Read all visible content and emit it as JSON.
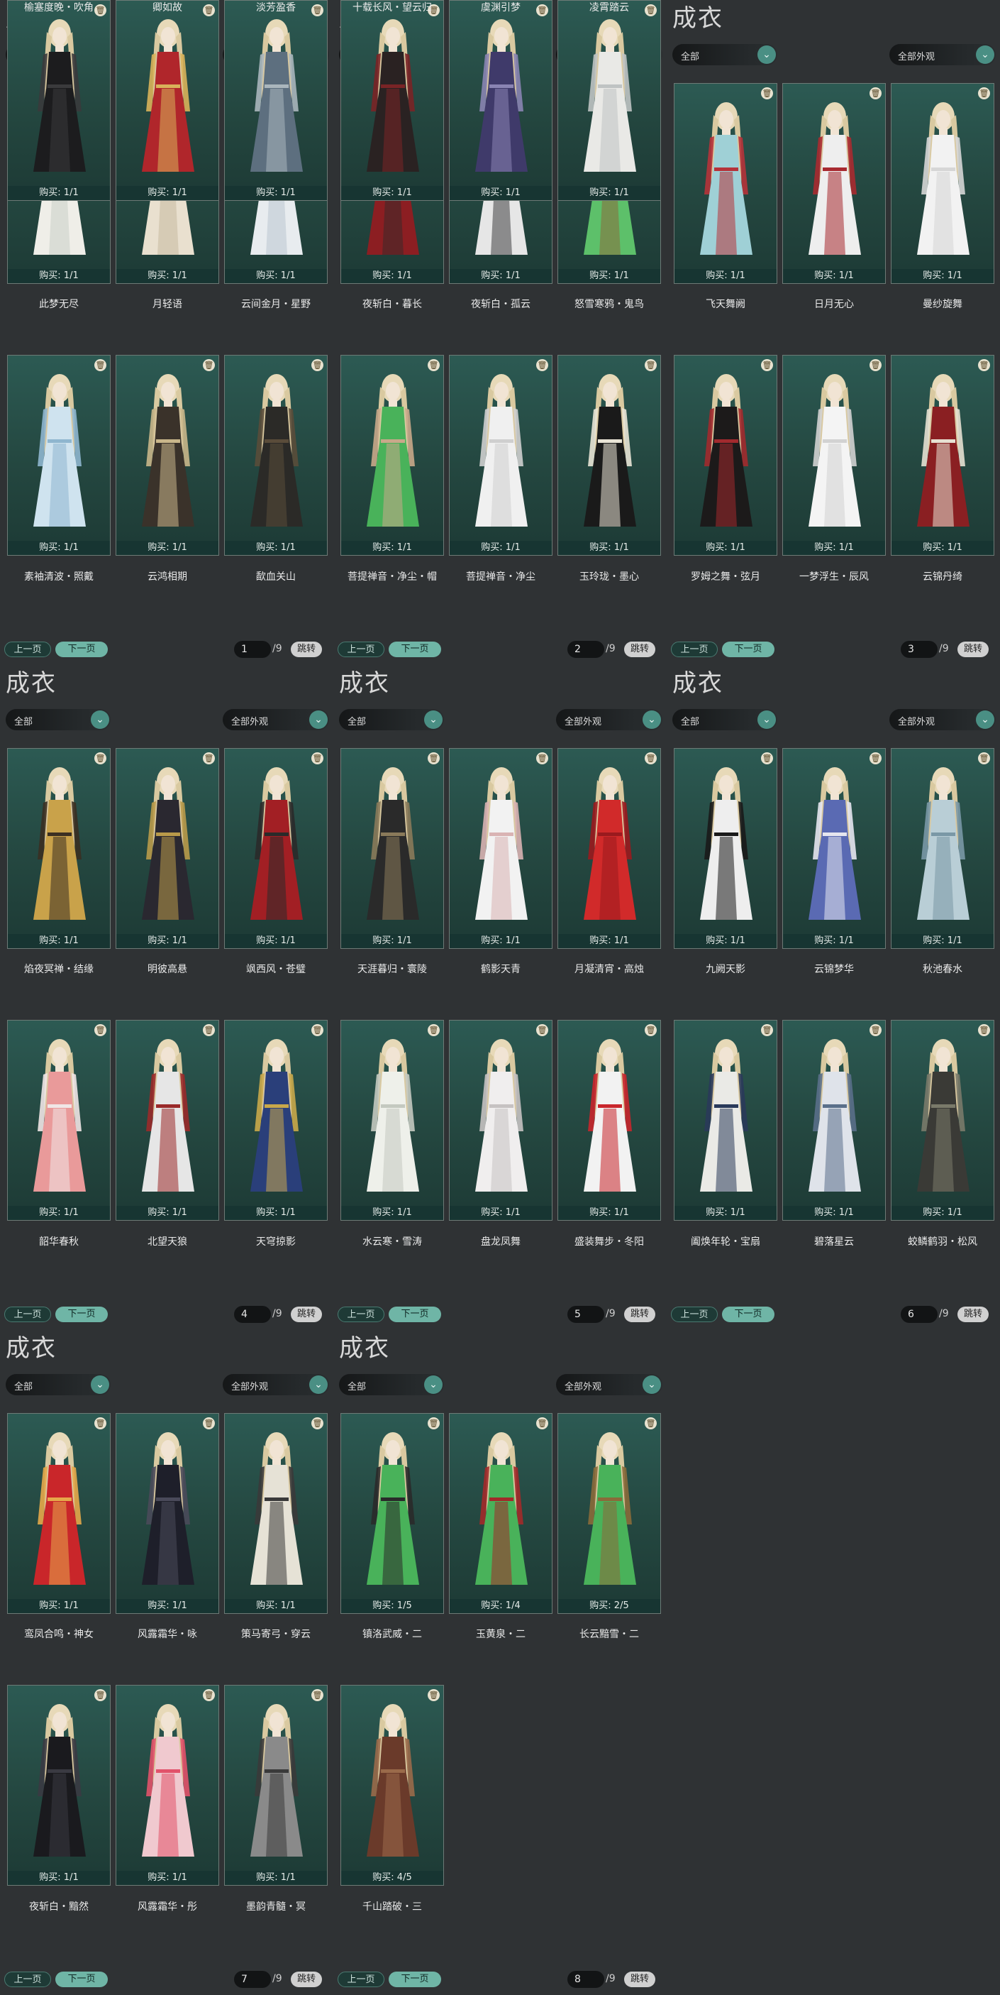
{
  "title": "成衣",
  "filter_all": "全部",
  "filter_appearance": "全部外观",
  "prev_label": "上一页",
  "next_label": "下一页",
  "jump_label": "跳转",
  "total_pages": "/9",
  "colors": {
    "accent": "#6fb5a6",
    "card_bg": "#2c5a53",
    "page_bg": "#2f3234"
  },
  "pages": [
    {
      "page": "1",
      "items": [
        {
          "name": "此梦无尽",
          "buy": "购买: 1/1",
          "c1": "#efeee8",
          "c2": "#c9cfc6"
        },
        {
          "name": "月轻语",
          "buy": "购买: 1/1",
          "c1": "#e9e0cf",
          "c2": "#c7b9a0"
        },
        {
          "name": "云间金月・星野",
          "buy": "购买: 1/1",
          "c1": "#e8ecef",
          "c2": "#b9c7cf"
        },
        {
          "name": "素袖清波・照戴",
          "buy": "购买: 1/1",
          "c1": "#cfe3ef",
          "c2": "#8fb6cf"
        },
        {
          "name": "云鸿相期",
          "buy": "购买: 1/1",
          "c1": "#3a322a",
          "c2": "#c9b68a"
        },
        {
          "name": "歃血关山",
          "buy": "购买: 1/1",
          "c1": "#2b2a27",
          "c2": "#5a4c3a"
        },
        {
          "name": "榆塞度晚・吹角",
          "buy": "购买: 1/1",
          "c1": "#1c1c1e",
          "c2": "#3a3a3c"
        },
        {
          "name": "卿如故",
          "buy": "购买: 1/1",
          "c1": "#b0262b",
          "c2": "#d9b25a"
        },
        {
          "name": "淡芳盈香",
          "buy": "购买: 1/1",
          "c1": "#5d6f7f",
          "c2": "#aab6bd"
        }
      ]
    },
    {
      "page": "2",
      "items": [
        {
          "name": "夜斩白・暮长",
          "buy": "购买: 1/1",
          "c1": "#8c1e22",
          "c2": "#3a2a2a"
        },
        {
          "name": "夜斩白・孤云",
          "buy": "购买: 1/1",
          "c1": "#e6e6e6",
          "c2": "#3f3f42"
        },
        {
          "name": "怒雪寒鸦・鬼鸟",
          "buy": "购买: 1/1",
          "c1": "#5dc06a",
          "c2": "#8a6a3a"
        },
        {
          "name": "菩提禅音・净尘・帽",
          "buy": "购买: 1/1",
          "c1": "#49b25a",
          "c2": "#c9a88a"
        },
        {
          "name": "菩提禅音・净尘",
          "buy": "购买: 1/1",
          "c1": "#f0f0f0",
          "c2": "#cfcfcf"
        },
        {
          "name": "玉玲珑・墨心",
          "buy": "购买: 1/1",
          "c1": "#1a1a1a",
          "c2": "#e9e4d6"
        },
        {
          "name": "十载长风・望云归",
          "buy": "购买: 1/1",
          "c1": "#2a2222",
          "c2": "#7a2426"
        },
        {
          "name": "虞渊引梦",
          "buy": "购买: 1/1",
          "c1": "#3f3a6a",
          "c2": "#8a84b3"
        },
        {
          "name": "凌霄踏云",
          "buy": "购买: 1/1",
          "c1": "#e9e9e6",
          "c2": "#bfc3c3"
        }
      ]
    },
    {
      "page": "3",
      "items": [
        {
          "name": "飞天舞阙",
          "buy": "购买: 1/1",
          "c1": "#9fd0d6",
          "c2": "#b6333a"
        },
        {
          "name": "日月无心",
          "buy": "购买: 1/1",
          "c1": "#eeeeee",
          "c2": "#a82a30"
        },
        {
          "name": "曼纱旋舞",
          "buy": "购买: 1/1",
          "c1": "#f2f2f2",
          "c2": "#d6d6d6"
        },
        {
          "name": "罗姆之舞・弦月",
          "buy": "购买: 1/1",
          "c1": "#1c1a1a",
          "c2": "#a22a2e"
        },
        {
          "name": "一梦浮生・辰风",
          "buy": "购买: 1/1",
          "c1": "#f4f4f4",
          "c2": "#d2d2d2"
        },
        {
          "name": "云锦丹绮",
          "buy": "购买: 1/1",
          "c1": "#8a1f22",
          "c2": "#e6e0d2"
        }
      ]
    },
    {
      "page": "4",
      "items": [
        {
          "name": "焰夜冥禅・结缘",
          "buy": "购买: 1/1",
          "c1": "#c9a24a",
          "c2": "#3a2f22"
        },
        {
          "name": "明彼高悬",
          "buy": "购买: 1/1",
          "c1": "#2a2830",
          "c2": "#b99a4a"
        },
        {
          "name": "飒西风・苍璧",
          "buy": "购买: 1/1",
          "c1": "#a21f24",
          "c2": "#2a2a2a"
        },
        {
          "name": "韶华春秋",
          "buy": "购买: 1/1",
          "c1": "#e99a9a",
          "c2": "#f0e6e6"
        },
        {
          "name": "北望天狼",
          "buy": "购买: 1/1",
          "c1": "#e6e6e6",
          "c2": "#9a2a2a"
        },
        {
          "name": "天穹掠影",
          "buy": "购买: 1/1",
          "c1": "#2a3f7a",
          "c2": "#c9a84a"
        }
      ]
    },
    {
      "page": "5",
      "items": [
        {
          "name": "天涯暮归・寰陵",
          "buy": "购买: 1/1",
          "c1": "#2a2a2a",
          "c2": "#8a7a5a"
        },
        {
          "name": "鹤影天青",
          "buy": "购买: 1/1",
          "c1": "#f2f2f2",
          "c2": "#d9b3b3"
        },
        {
          "name": "月凝清宵・高烛",
          "buy": "购买: 1/1",
          "c1": "#d12a2a",
          "c2": "#9a1a1e"
        },
        {
          "name": "水云寒・雪涛",
          "buy": "购买: 1/1",
          "c1": "#eef0ea",
          "c2": "#c4c9c0"
        },
        {
          "name": "盘龙凤舞",
          "buy": "购买: 1/1",
          "c1": "#f0eeee",
          "c2": "#c6c2c2"
        },
        {
          "name": "盛装舞步・冬阳",
          "buy": "购买: 1/1",
          "c1": "#f2f2f2",
          "c2": "#c9262c"
        }
      ]
    },
    {
      "page": "6",
      "items": [
        {
          "name": "九阙天影",
          "buy": "购买: 1/1",
          "c1": "#eeeeee",
          "c2": "#1a1a1a"
        },
        {
          "name": "云锦梦华",
          "buy": "购买: 1/1",
          "c1": "#5a6ab3",
          "c2": "#e6e6ef"
        },
        {
          "name": "秋池春水",
          "buy": "购买: 1/1",
          "c1": "#b9ced6",
          "c2": "#7a98a6"
        },
        {
          "name": "阖焕年轮・宝扇",
          "buy": "购买: 1/1",
          "c1": "#eaeae6",
          "c2": "#2a3a5a"
        },
        {
          "name": "碧落星云",
          "buy": "购买: 1/1",
          "c1": "#dfe3ea",
          "c2": "#5a6f8a"
        },
        {
          "name": "蛟鳞鹤羽・松风",
          "buy": "购买: 1/1",
          "c1": "#3a3a36",
          "c2": "#7a7a6a"
        }
      ]
    },
    {
      "page": "7",
      "items": [
        {
          "name": "鸾凤合鸣・神女",
          "buy": "购买: 1/1",
          "c1": "#c9262a",
          "c2": "#e6a84a"
        },
        {
          "name": "风露霜华・咏",
          "buy": "购买: 1/1",
          "c1": "#1e1f2a",
          "c2": "#4a4a5a"
        },
        {
          "name": "策马寄弓・穿云",
          "buy": "购买: 1/1",
          "c1": "#e6e2d6",
          "c2": "#3a3a3a"
        },
        {
          "name": "夜斩白・黯然",
          "buy": "购买: 1/1",
          "c1": "#1a1a1e",
          "c2": "#3a3a42"
        },
        {
          "name": "风露霜华・彤",
          "buy": "购买: 1/1",
          "c1": "#f0c9cf",
          "c2": "#e2526a"
        },
        {
          "name": "墨韵青髓・冥",
          "buy": "购买: 1/1",
          "c1": "#8a8a8a",
          "c2": "#3a3a3a"
        }
      ]
    },
    {
      "page": "8",
      "items": [
        {
          "name": "镇洛武威・二",
          "buy": "购买: 1/5",
          "c1": "#49b25a",
          "c2": "#2a2a2a"
        },
        {
          "name": "玉黄泉・二",
          "buy": "购买: 1/4",
          "c1": "#49b25a",
          "c2": "#a22a2a"
        },
        {
          "name": "长云黯雪・二",
          "buy": "购买: 2/5",
          "c1": "#49b25a",
          "c2": "#8a6a3a"
        },
        {
          "name": "千山踏破・三",
          "buy": "购买: 4/5",
          "c1": "#6a3a2a",
          "c2": "#9a6a4a"
        }
      ]
    }
  ]
}
